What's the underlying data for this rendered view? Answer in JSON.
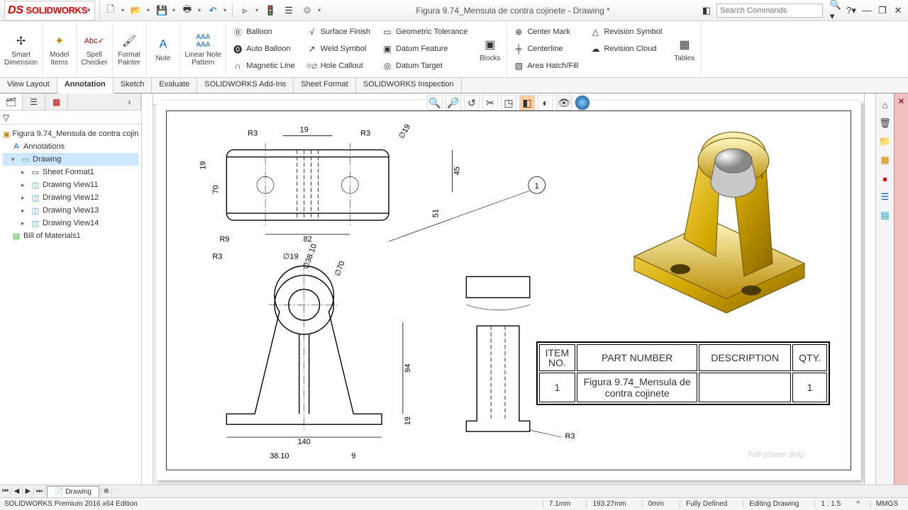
{
  "app": {
    "logo_prefix": "DS",
    "logo_text": "SOLIDWORKS",
    "title": "Figura 9.74_Mensula de contra cojinete - Drawing *",
    "search_placeholder": "Search Commands"
  },
  "ribbon": {
    "smart_dimension": "Smart\nDimension",
    "model_items": "Model\nItems",
    "spell_checker": "Spell\nChecker",
    "format_painter": "Format\nPainter",
    "note": "Note",
    "linear_note": "Linear Note\nPattern",
    "balloon": "Balloon",
    "auto_balloon": "Auto Balloon",
    "magnetic_line": "Magnetic Line",
    "surface_finish": "Surface Finish",
    "weld_symbol": "Weld Symbol",
    "hole_callout": "Hole Callout",
    "geo_tol": "Geometric Tolerance",
    "datum_feature": "Datum Feature",
    "datum_target": "Datum Target",
    "blocks": "Blocks",
    "center_mark": "Center Mark",
    "centerline": "Centerline",
    "area_hatch": "Area Hatch/Fill",
    "revision_symbol": "Revision Symbol",
    "revision_cloud": "Revision Cloud",
    "tables": "Tables"
  },
  "tabs": {
    "view_layout": "View Layout",
    "annotation": "Annotation",
    "sketch": "Sketch",
    "evaluate": "Evaluate",
    "addins": "SOLIDWORKS Add-Ins",
    "sheet_format": "Sheet Format",
    "inspection": "SOLIDWORKS Inspection"
  },
  "tree": {
    "root": "Figura 9.74_Mensula de contra cojin",
    "annotations": "Annotations",
    "drawing": "Drawing",
    "sheet_format": "Sheet Format1",
    "view11": "Drawing View11",
    "view12": "Drawing View12",
    "view13": "Drawing View13",
    "view14": "Drawing View14",
    "bom": "Bill of Materials1"
  },
  "bom": {
    "h_item": "ITEM NO.",
    "h_part": "PART NUMBER",
    "h_desc": "DESCRIPTION",
    "h_qty": "QTY.",
    "r1_item": "1",
    "r1_part": "Figura 9.74_Mensula de contra cojinete",
    "r1_desc": "",
    "r1_qty": "1"
  },
  "dims": {
    "d19a": "19",
    "d19b": "19",
    "d19c": "19",
    "d19d": "∅19",
    "d19e": "∅19",
    "d45": "45",
    "d51": "51",
    "d70": "70",
    "d82": "82",
    "d94": "94",
    "d140": "140",
    "d9": "9",
    "d38_10a": "∅38.10",
    "d38_10b": "38.10",
    "d70dia": "∅70",
    "r3a": "R3",
    "r3b": "R3",
    "r3c": "R3",
    "r3d": "R3",
    "r9": "R9",
    "ball1": "1"
  },
  "sheet_tab": "Drawing",
  "status": {
    "edition": "SOLIDWORKS Premium 2016 x64 Edition",
    "x": "7.1mm",
    "y": "193.27mm",
    "z": "0mm",
    "defined": "Fully Defined",
    "editing": "Editing Drawing",
    "scale": "1 : 1.5",
    "units": "MMGS"
  },
  "snip": "Full-screen Snip"
}
